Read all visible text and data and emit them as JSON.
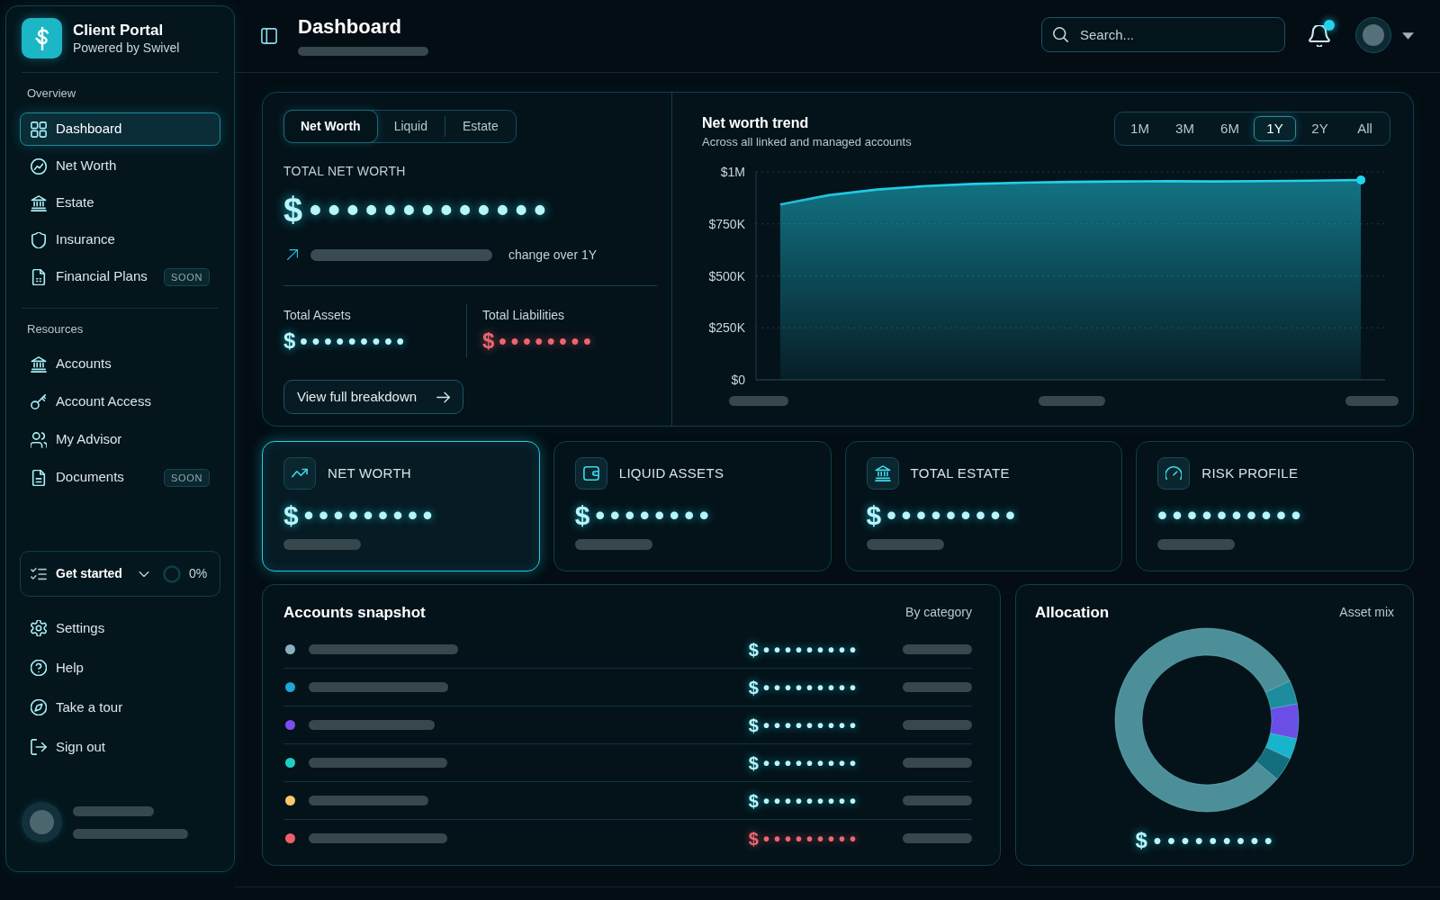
{
  "sidebar": {
    "brand": {
      "title": "Client Portal",
      "subtitle": "Powered by Swivel"
    },
    "sections": [
      {
        "heading": "Overview",
        "items": [
          {
            "label": "Dashboard",
            "selected": true
          },
          {
            "label": "Net Worth",
            "selected": false
          },
          {
            "label": "Estate",
            "selected": false
          },
          {
            "label": "Insurance",
            "selected": false
          },
          {
            "label": "Financial Plans",
            "selected": false,
            "badge": "SOON"
          }
        ]
      },
      {
        "heading": "Resources",
        "items": [
          {
            "label": "Accounts",
            "selected": false
          },
          {
            "label": "Account Access",
            "selected": false
          },
          {
            "label": "My Advisor",
            "selected": false
          },
          {
            "label": "Documents",
            "selected": false,
            "badge": "SOON"
          }
        ]
      }
    ],
    "get_started": {
      "label": "Get started",
      "expanded": false,
      "level": 0,
      "reading": "0%"
    },
    "footer_items": [
      {
        "label": "Settings",
        "selected": false
      },
      {
        "label": "Help",
        "selected": false
      },
      {
        "label": "Take a tour",
        "selected": false
      },
      {
        "label": "Sign out",
        "selected": false
      }
    ]
  },
  "header": {
    "title": "Dashboard",
    "search": {
      "placeholder": "Search..."
    },
    "notifications": {
      "unread": true
    }
  },
  "net_worth": {
    "tabs": [
      {
        "label": "Net Worth",
        "selected": true
      },
      {
        "label": "Liquid",
        "selected": false
      },
      {
        "label": "Estate",
        "selected": false
      }
    ],
    "total_label": "TOTAL NET WORTH",
    "total_value": "$•••••••••••••",
    "change_caption": "change over 1Y",
    "totals": [
      {
        "label": "Total Assets",
        "value": "$•••••••••",
        "negative": false
      },
      {
        "label": "Total Liabilities",
        "value": "$••••••••",
        "negative": true
      }
    ],
    "breakdown_button": "View full breakdown"
  },
  "trend": {
    "title": "Net worth trend",
    "subtitle": "Across all linked and managed accounts",
    "periods": [
      {
        "label": "1M",
        "selected": false
      },
      {
        "label": "3M",
        "selected": false
      },
      {
        "label": "6M",
        "selected": false
      },
      {
        "label": "1Y",
        "selected": true
      },
      {
        "label": "2Y",
        "selected": false
      },
      {
        "label": "All",
        "selected": false
      }
    ],
    "chart_data": {
      "type": "area",
      "grid": true,
      "series": [
        {
          "color": "#22d3ee",
          "values": [
            843000,
            888000,
            915000,
            932000,
            942000,
            948000,
            952000,
            954000,
            955000,
            954000,
            956000,
            958000,
            961000
          ]
        }
      ],
      "ylim": [
        0,
        1000000
      ],
      "yticks": [
        {
          "value": 0,
          "label": "$0"
        },
        {
          "value": 250000,
          "label": "$250K"
        },
        {
          "value": 500000,
          "label": "$500K"
        },
        {
          "value": 750000,
          "label": "$750K"
        },
        {
          "value": 1000000,
          "label": "$1M"
        }
      ]
    }
  },
  "stat_cards": [
    {
      "label": "NET WORTH",
      "value": "$•••••••••",
      "selected": true
    },
    {
      "label": "LIQUID ASSETS",
      "value": "$••••••••",
      "selected": false
    },
    {
      "label": "TOTAL ESTATE",
      "value": "$•••••••••",
      "selected": false
    },
    {
      "label": "RISK PROFILE",
      "value": "••••••••••",
      "selected": false
    }
  ],
  "accounts": {
    "title": "Accounts snapshot",
    "caption": "By category",
    "rows": [
      {
        "color": "#8aaebf",
        "value": "$•••••••••",
        "negative": false
      },
      {
        "color": "#1ea6d6",
        "value": "$•••••••••",
        "negative": false
      },
      {
        "color": "#7b4ff0",
        "value": "$•••••••••",
        "negative": false
      },
      {
        "color": "#1ccfc0",
        "value": "$•••••••••",
        "negative": false
      },
      {
        "color": "#f7c96b",
        "value": "$•••••••••",
        "negative": false
      },
      {
        "color": "#ef5f6a",
        "value": "$•••••••••",
        "negative": true
      }
    ]
  },
  "allocation": {
    "title": "Allocation",
    "caption": "Asset mix",
    "total": "$•••••••••"
  }
}
